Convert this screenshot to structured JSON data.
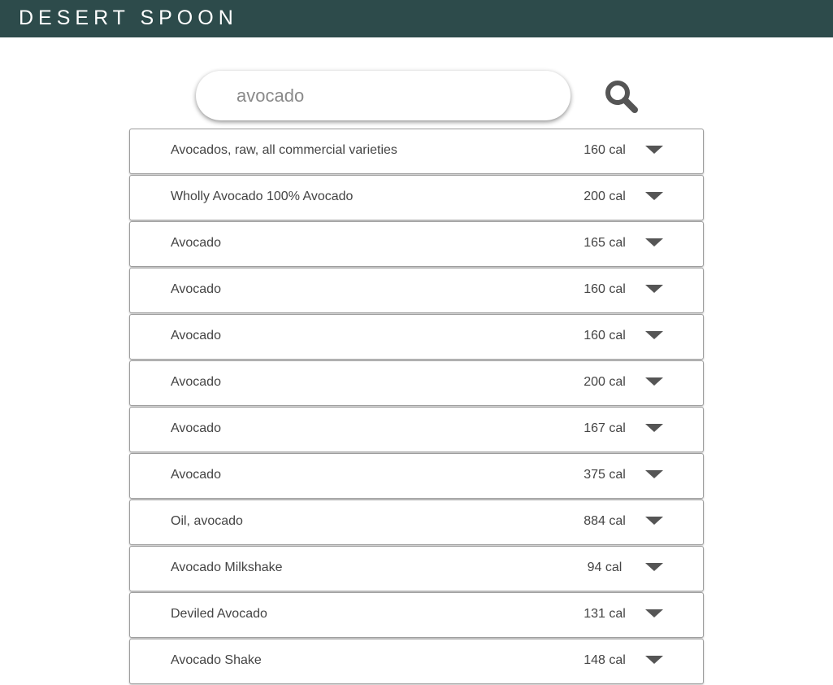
{
  "header": {
    "brand": "DESERT SPOON"
  },
  "search": {
    "value": "avocado",
    "icon": "search-icon"
  },
  "results": [
    {
      "name": "Avocados, raw, all commercial varieties",
      "cal": "160 cal"
    },
    {
      "name": "Wholly Avocado 100% Avocado",
      "cal": "200 cal"
    },
    {
      "name": "Avocado",
      "cal": "165 cal"
    },
    {
      "name": "Avocado",
      "cal": "160 cal"
    },
    {
      "name": "Avocado",
      "cal": "160 cal"
    },
    {
      "name": "Avocado",
      "cal": "200 cal"
    },
    {
      "name": "Avocado",
      "cal": "167 cal"
    },
    {
      "name": "Avocado",
      "cal": "375 cal"
    },
    {
      "name": "Oil, avocado",
      "cal": "884 cal"
    },
    {
      "name": "Avocado Milkshake",
      "cal": "94 cal"
    },
    {
      "name": "Deviled Avocado",
      "cal": "131 cal"
    },
    {
      "name": "Avocado Shake",
      "cal": "148 cal"
    }
  ],
  "colors": {
    "header_bg": "#2d4b4b",
    "text": "#444444",
    "icon": "#555555"
  }
}
